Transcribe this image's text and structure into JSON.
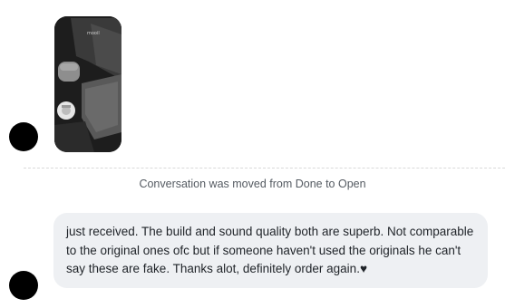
{
  "messages": [
    {
      "type": "image",
      "sender": "customer",
      "image_caption_text": "mooil"
    },
    {
      "type": "system",
      "text": "Conversation was moved from Done to Open"
    },
    {
      "type": "text",
      "sender": "customer",
      "text": "just received. The build and sound quality both are superb. Not comparable to the original ones ofc but if someone haven't used the originals he can't say these are fake. Thanks alot, definitely order again.♥"
    }
  ],
  "colors": {
    "avatar": "#000000",
    "bubble_bg": "#eef0f3",
    "system_text": "#555b62",
    "divider": "#d9d9d9"
  }
}
